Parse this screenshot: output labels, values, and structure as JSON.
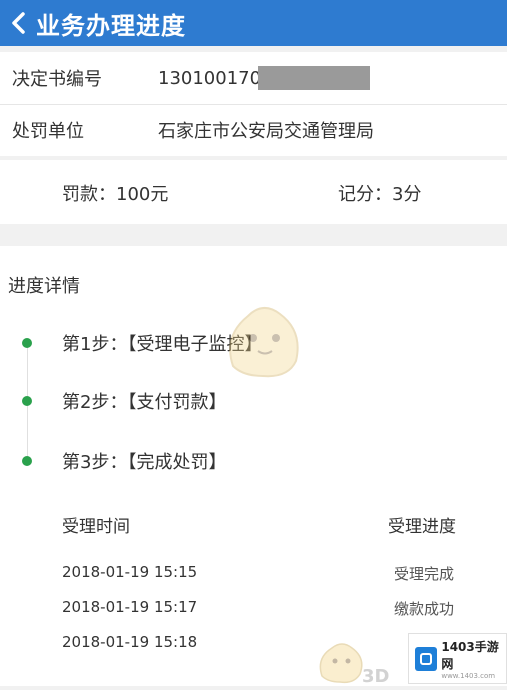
{
  "header": {
    "title": "业务办理进度"
  },
  "info": [
    {
      "label": "决定书编号",
      "value": "130100170"
    },
    {
      "label": "处罚单位",
      "value": "石家庄市公安局交通管理局"
    }
  ],
  "fine": {
    "amount": "罚款：100元",
    "points": "记分：3分"
  },
  "progress": {
    "title": "进度详情",
    "steps": [
      "第1步：【受理电子监控】",
      "第2步：【支付罚款】",
      "第3步：【完成处罚】"
    ],
    "table": {
      "headers": [
        "受理时间",
        "受理进度"
      ],
      "rows": [
        {
          "time": "2018-01-19 15:15",
          "status": "受理完成"
        },
        {
          "time": "2018-01-19 15:17",
          "status": "缴款成功"
        },
        {
          "time": "2018-01-19 15:18",
          "status": ""
        }
      ]
    }
  },
  "watermark": {
    "brand": "1403手游网",
    "url": "www.1403.com",
    "text": "3D"
  },
  "colors": {
    "header": "#2e7bd0",
    "step_dot": "#2aa14c"
  }
}
